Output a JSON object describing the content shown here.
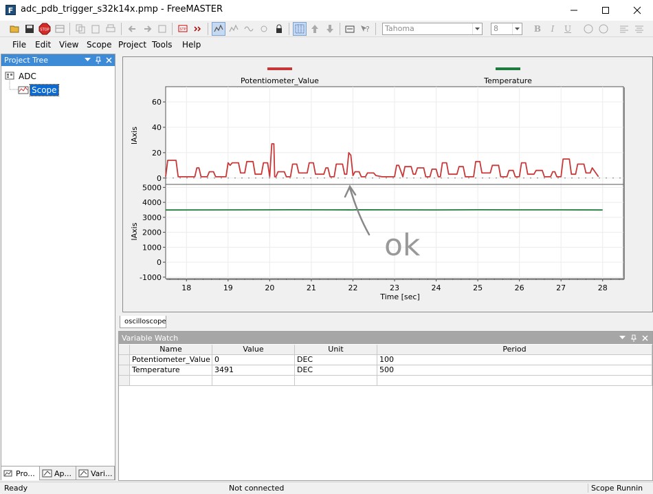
{
  "window": {
    "title": "adc_pdb_trigger_s32k14x.pmp - FreeMASTER",
    "app_icon_letter": "F"
  },
  "toolbar": {
    "font_name": "Tahoma",
    "font_size": "8",
    "bold_label": "B",
    "italic_label": "I",
    "underline_label": "U"
  },
  "menu": [
    {
      "label": "File"
    },
    {
      "label": "Edit"
    },
    {
      "label": "View"
    },
    {
      "label": "Scope"
    },
    {
      "label": "Project"
    },
    {
      "label": "Tools"
    },
    {
      "label": "Help"
    }
  ],
  "project_tree": {
    "title": "Project Tree",
    "root": "ADC",
    "child": "Scope",
    "tabs": [
      {
        "label": "Pro..."
      },
      {
        "label": "Ap..."
      },
      {
        "label": "Vari..."
      }
    ]
  },
  "scope": {
    "tab_label": "oscilloscope",
    "annotation": "ok"
  },
  "chart_data": {
    "type": "line",
    "xlabel": "Time [sec]",
    "xlim": [
      17.5,
      28.5
    ],
    "xticks": [
      18,
      19,
      20,
      21,
      22,
      23,
      24,
      25,
      26,
      27,
      28
    ],
    "legend": [
      {
        "name": "Potentiometer_Value",
        "color": "#c83737"
      },
      {
        "name": "Temperature",
        "color": "#1f7a3d"
      }
    ],
    "legend_placement": "top",
    "grid": true,
    "panels": [
      {
        "ylabel": "lAxis",
        "ylim": [
          -5,
          72
        ],
        "yticks": [
          0,
          20,
          40,
          60
        ],
        "series": [
          {
            "name": "Potentiometer_Value",
            "color": "#c83737",
            "x": [
              17.5,
              17.55,
              17.6,
              17.75,
              17.8,
              18.2,
              18.25,
              18.3,
              18.35,
              18.5,
              18.55,
              18.65,
              18.7,
              18.95,
              19.0,
              19.05,
              19.1,
              19.25,
              19.3,
              19.4,
              19.45,
              19.6,
              19.65,
              19.8,
              19.85,
              19.95,
              20.0,
              20.05,
              20.1,
              20.12,
              20.15,
              20.2,
              20.35,
              20.4,
              20.5,
              20.55,
              20.65,
              20.7,
              20.9,
              20.95,
              21.05,
              21.1,
              21.3,
              21.35,
              21.4,
              21.45,
              21.55,
              21.6,
              21.75,
              21.8,
              21.85,
              21.9,
              21.95,
              22.0,
              22.05,
              22.15,
              22.2,
              22.3,
              22.35,
              22.5,
              22.55,
              22.7,
              23.0,
              23.05,
              23.1,
              23.2,
              23.25,
              23.4,
              23.45,
              23.5,
              23.55,
              23.7,
              23.75,
              23.85,
              23.9,
              24.0,
              24.05,
              24.1,
              24.15,
              24.25,
              24.3,
              24.5,
              24.55,
              24.65,
              24.7,
              24.9,
              24.95,
              25.05,
              25.1,
              25.3,
              25.35,
              25.5,
              25.55,
              25.7,
              25.75,
              25.85,
              25.9,
              26.0,
              26.05,
              26.15,
              26.2,
              26.35,
              26.4,
              26.55,
              26.6,
              26.75,
              26.8,
              26.85,
              26.9,
              27.0,
              27.05,
              27.2,
              27.25,
              27.35,
              27.4,
              27.55,
              27.6,
              27.7,
              27.75,
              27.9
            ],
            "y": [
              1,
              14,
              14,
              14,
              1,
              1,
              8,
              8,
              1,
              1,
              5,
              5,
              1,
              1,
              12,
              10,
              12,
              12,
              4,
              4,
              13,
              13,
              3,
              3,
              12,
              12,
              1,
              27,
              27,
              1,
              1,
              5,
              5,
              1,
              1,
              11,
              11,
              4,
              4,
              12,
              12,
              3,
              3,
              8,
              8,
              1,
              1,
              11,
              11,
              3,
              3,
              20,
              18,
              2,
              5,
              5,
              1,
              1,
              4,
              4,
              2,
              1,
              1,
              10,
              10,
              1,
              9,
              9,
              3,
              3,
              8,
              8,
              1,
              1,
              7,
              7,
              1,
              1,
              12,
              12,
              3,
              3,
              9,
              9,
              1,
              1,
              13,
              13,
              4,
              4,
              10,
              10,
              1,
              1,
              6,
              6,
              1,
              1,
              12,
              12,
              3,
              3,
              6,
              6,
              1,
              1,
              5,
              5,
              1,
              1,
              15,
              15,
              3,
              3,
              11,
              11,
              4,
              4,
              8,
              1
            ]
          }
        ]
      },
      {
        "ylabel": "lAxis",
        "ylim": [
          -1100,
          5200
        ],
        "yticks": [
          -1000,
          0,
          1000,
          2000,
          3000,
          4000,
          5000
        ],
        "series": [
          {
            "name": "Temperature",
            "color": "#1f7a3d",
            "x": [
              17.5,
              18.5,
              19.5,
              20.5,
              21.5,
              22.0,
              22.05,
              23.0,
              24.0,
              25.0,
              26.0,
              27.0,
              28.0
            ],
            "y": [
              3491,
              3495,
              3500,
              3505,
              3498,
              3495,
              3505,
              3500,
              3495,
              3502,
              3498,
              3500,
              3491
            ]
          }
        ]
      }
    ]
  },
  "watch": {
    "title": "Variable Watch",
    "columns": [
      "Name",
      "Value",
      "Unit",
      "Period"
    ],
    "rows": [
      [
        "Potentiometer_Value",
        "0",
        "DEC",
        "100"
      ],
      [
        "Temperature",
        "3491",
        "DEC",
        "500"
      ]
    ]
  },
  "status": {
    "left": "Ready",
    "middle": "Not connected",
    "right": "Scope Runnin"
  }
}
